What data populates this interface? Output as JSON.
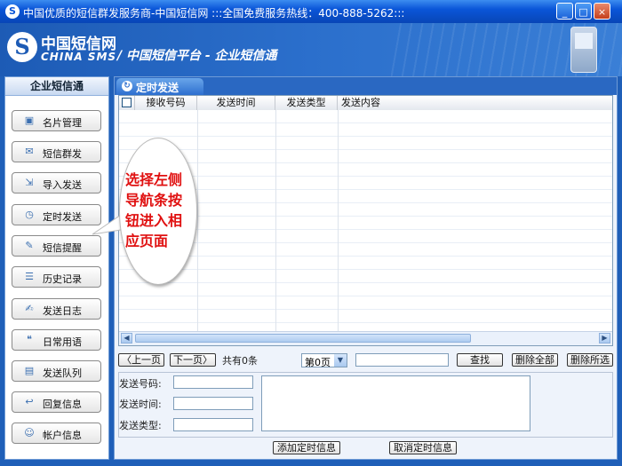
{
  "window": {
    "title": "中国优质的短信群发服务商-中国短信网 :::全国免费服务热线：400-888-5262:::",
    "minimize": "_",
    "maximize": "□",
    "close": "×"
  },
  "banner": {
    "logo_glyph": "S",
    "logo_cn": "中国短信网",
    "logo_en": "CHINA SMS",
    "platform_text": "/ 中国短信平台 - 企业短信通"
  },
  "sidebar": {
    "title": "企业短信通",
    "items": [
      {
        "label": "名片管理",
        "icon": "card-icon",
        "glyph": "▣"
      },
      {
        "label": "短信群发",
        "icon": "group-send-icon",
        "glyph": "✉"
      },
      {
        "label": "导入发送",
        "icon": "import-icon",
        "glyph": "⇲"
      },
      {
        "label": "定时发送",
        "icon": "clock-icon",
        "glyph": "◷"
      },
      {
        "label": "短信提醒",
        "icon": "reminder-icon",
        "glyph": "✎"
      },
      {
        "label": "历史记录",
        "icon": "history-icon",
        "glyph": "☰"
      },
      {
        "label": "发送日志",
        "icon": "log-icon",
        "glyph": "✍"
      },
      {
        "label": "日常用语",
        "icon": "phrases-icon",
        "glyph": "❝"
      },
      {
        "label": "发送队列",
        "icon": "queue-icon",
        "glyph": "▤"
      },
      {
        "label": "回复信息",
        "icon": "reply-icon",
        "glyph": "↩"
      },
      {
        "label": "帐户信息",
        "icon": "account-icon",
        "glyph": "☺"
      }
    ]
  },
  "main": {
    "tab_label": "定时发送",
    "table": {
      "columns": [
        "接收号码",
        "发送时间",
        "发送类型",
        "发送内容"
      ]
    },
    "pager": {
      "prev": "〈上一页",
      "next": "下一页〉",
      "total": "共有0条",
      "page_select": "第0页",
      "search": "查找",
      "delete_all": "删除全部",
      "delete_selected": "删除所选"
    },
    "form": {
      "number_label": "发送号码:",
      "time_label": "发送时间:",
      "type_label": "发送类型:",
      "add_button": "添加定时信息",
      "cancel_button": "取消定时信息"
    }
  },
  "callout": {
    "text": "选择左侧导航条按钮进入相应页面"
  },
  "colors": {
    "window_blue": "#1f5fb8",
    "callout_red": "#e01010",
    "titlebar_blue": "#0a55d8"
  }
}
